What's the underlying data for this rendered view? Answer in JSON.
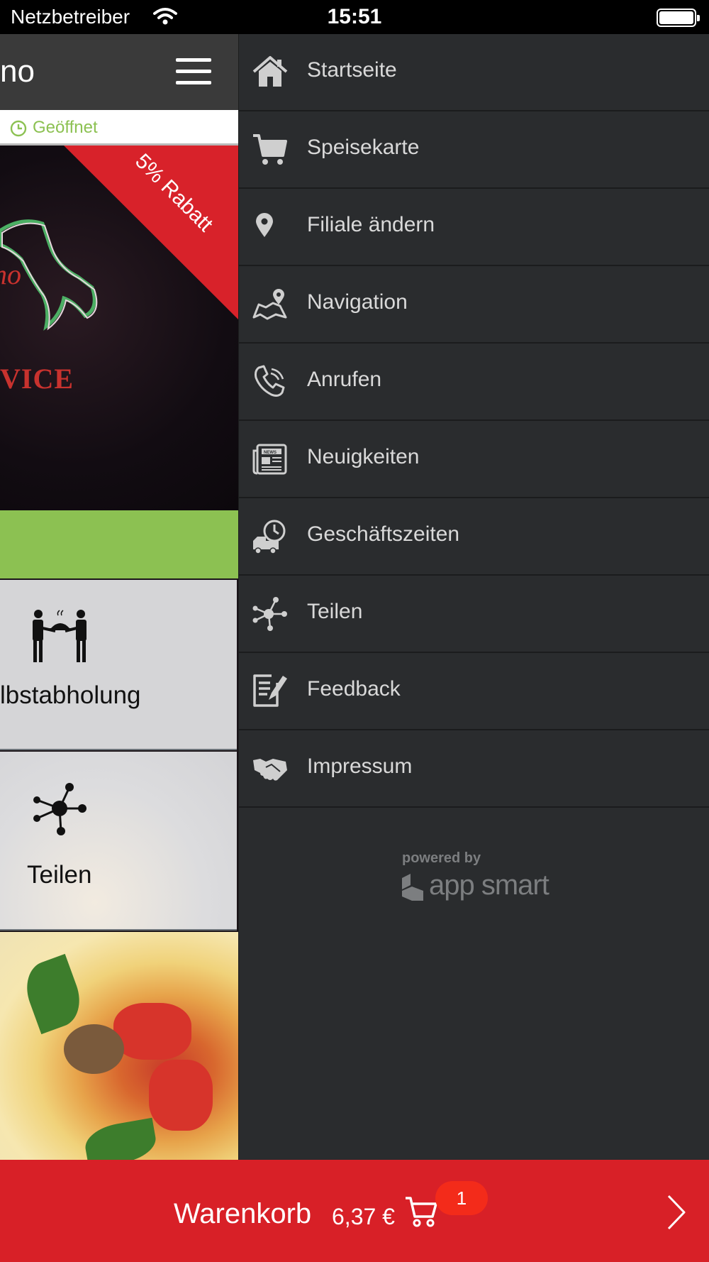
{
  "status_bar": {
    "carrier": "Netzbetreiber",
    "time": "15:51"
  },
  "app_bar": {
    "title_partial": "no"
  },
  "open_status": {
    "text": "Geöffnet"
  },
  "hero": {
    "logo_text_partial": "VICE",
    "discount_text": "5% Rabatt",
    "discount_color": "#d8222a"
  },
  "tiles": [
    {
      "label": "lbstabholung",
      "icon": "waiter-pickup-icon"
    },
    {
      "label": "Teilen",
      "icon": "share-icon"
    }
  ],
  "menu": {
    "items": [
      {
        "label": "Startseite",
        "icon": "home-icon"
      },
      {
        "label": "Speisekarte",
        "icon": "cart-icon"
      },
      {
        "label": "Filiale ändern",
        "icon": "location-pin-icon"
      },
      {
        "label": "Navigation",
        "icon": "map-icon"
      },
      {
        "label": "Anrufen",
        "icon": "phone-icon"
      },
      {
        "label": "Neuigkeiten",
        "icon": "newspaper-icon"
      },
      {
        "label": "Geschäftszeiten",
        "icon": "delivery-clock-icon"
      },
      {
        "label": "Teilen",
        "icon": "share-icon"
      },
      {
        "label": "Feedback",
        "icon": "feedback-icon"
      },
      {
        "label": "Impressum",
        "icon": "handshake-icon"
      }
    ],
    "powered_by": "powered by",
    "brand": "app smart"
  },
  "cart": {
    "label": "Warenkorb",
    "total": "6,37 €",
    "count": "1"
  },
  "colors": {
    "accent_green": "#8cc152",
    "cart_red": "#d82027",
    "drawer_bg": "#2a2c2e"
  }
}
